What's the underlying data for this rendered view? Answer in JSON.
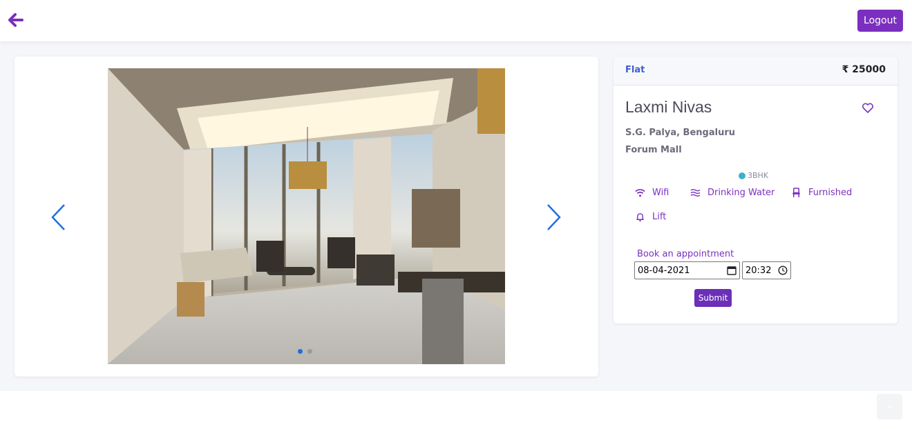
{
  "header": {
    "back_icon": "arrow-left-icon",
    "logout_label": "Logout",
    "accent_color": "#7b2fbf"
  },
  "carousel": {
    "prev_icon": "chevron-left-icon",
    "next_icon": "chevron-right-icon",
    "slide_count": 2,
    "active_slide": 1
  },
  "property": {
    "type": "Flat",
    "price": "₹ 25000",
    "name": "Laxmi Nivas",
    "address_line1": "S.G. Palya, Bengaluru",
    "address_line2": "Forum Mall",
    "bhk": "3BHK",
    "favorite_icon": "heart-icon",
    "amenities": [
      {
        "label": "Wifi",
        "icon": "wifi-icon"
      },
      {
        "label": "Drinking Water",
        "icon": "water-icon"
      },
      {
        "label": "Furnished",
        "icon": "chair-icon"
      },
      {
        "label": "Lift",
        "icon": "bell-icon"
      }
    ]
  },
  "appointment": {
    "label": "Book an appointment",
    "date_value": "08-04-2021",
    "time_value": "20:32",
    "submit_label": "Submit"
  }
}
